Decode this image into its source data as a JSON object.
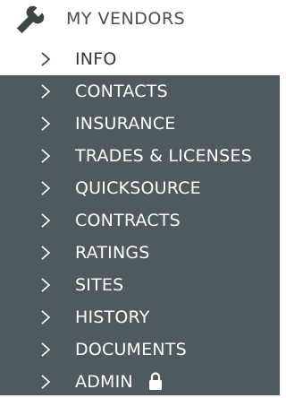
{
  "header": {
    "icon": "wrench-icon",
    "title": "MY VENDORS"
  },
  "nav": {
    "items": [
      {
        "label": "INFO",
        "active": true
      },
      {
        "label": "CONTACTS"
      },
      {
        "label": "INSURANCE"
      },
      {
        "label": "TRADES & LICENSES"
      },
      {
        "label": "QUICKSOURCE"
      },
      {
        "label": "CONTRACTS"
      },
      {
        "label": "RATINGS"
      },
      {
        "label": "SITES"
      },
      {
        "label": "HISTORY"
      },
      {
        "label": "DOCUMENTS"
      },
      {
        "label": "ADMIN",
        "icon": "lock-icon"
      }
    ]
  },
  "colors": {
    "sidebar_background": "#4f5a5e",
    "active_background": "#ffffff",
    "item_text": "#ffffff",
    "active_text": "#323a3e"
  }
}
